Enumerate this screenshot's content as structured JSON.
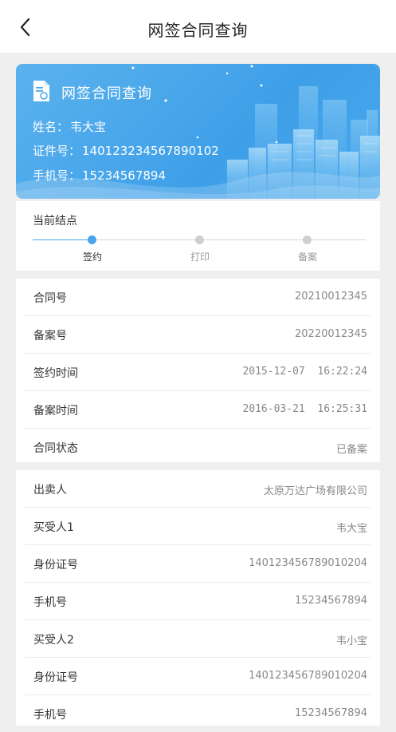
{
  "nav": {
    "title": "网签合同查询"
  },
  "banner": {
    "title": "网签合同查询",
    "name_label": "姓名：",
    "name_value": "韦大宝",
    "id_label": "证件号：",
    "id_value": "140123234567890102",
    "phone_label": "手机号：",
    "phone_value": "15234567894"
  },
  "progress": {
    "title": "当前结点",
    "steps": [
      {
        "label": "签约",
        "active": true
      },
      {
        "label": "打印",
        "active": false
      },
      {
        "label": "备案",
        "active": false
      }
    ]
  },
  "contract": {
    "rows": [
      {
        "key": "合同号",
        "value": "20210012345"
      },
      {
        "key": "备案号",
        "value": "20220012345"
      },
      {
        "key": "签约时间",
        "value": "2015-12-07  16:22:24"
      },
      {
        "key": "备案时间",
        "value": "2016-03-21  16:25:31"
      },
      {
        "key": "合同状态",
        "value": "已备案"
      }
    ]
  },
  "parties": {
    "rows": [
      {
        "key": "出卖人",
        "value": "太原万达广场有限公司"
      },
      {
        "key": "买受人1",
        "value": "韦大宝"
      },
      {
        "key": "身份证号",
        "value": "140123456789010204"
      },
      {
        "key": "手机号",
        "value": "15234567894"
      },
      {
        "key": "买受人2",
        "value": "韦小宝"
      },
      {
        "key": "身份证号",
        "value": "140123456789010204"
      },
      {
        "key": "手机号",
        "value": "15234567894"
      }
    ]
  },
  "colors": {
    "accent": "#49a6ea",
    "banner": "#4aa8ec",
    "background": "#efefef"
  }
}
